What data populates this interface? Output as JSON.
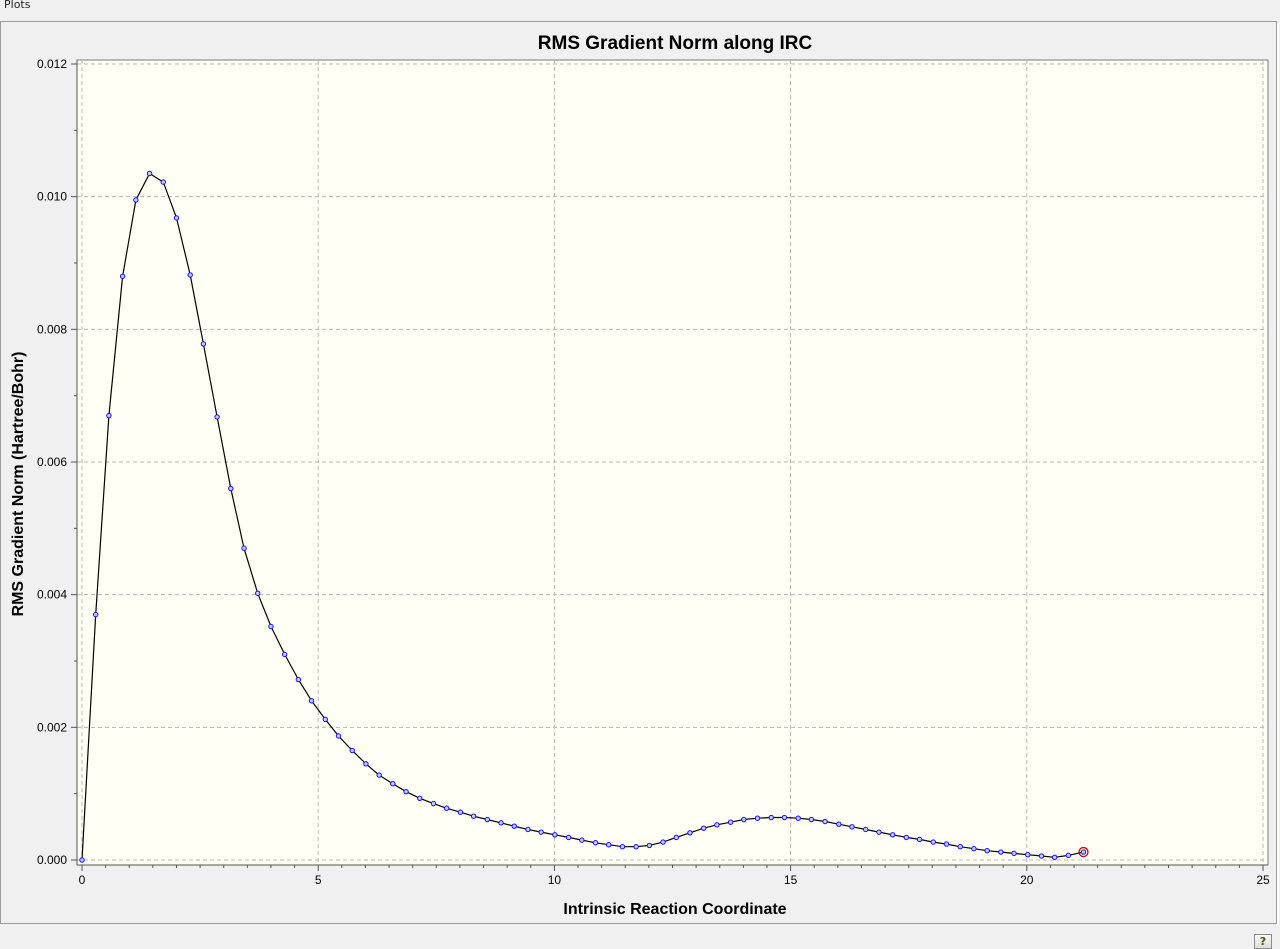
{
  "window": {
    "title": "Plots"
  },
  "help_icon": "help-icon",
  "chart_data": {
    "type": "line",
    "title": "RMS Gradient Norm along IRC",
    "xlabel": "Intrinsic Reaction Coordinate",
    "ylabel": "RMS Gradient Norm (Hartree/Bohr)",
    "xlim": [
      0,
      25
    ],
    "ylim": [
      0,
      0.012
    ],
    "x_ticks": [
      "0",
      "5",
      "10",
      "15",
      "20",
      "25"
    ],
    "y_ticks": [
      "0.000",
      "0.002",
      "0.004",
      "0.006",
      "0.008",
      "0.010",
      "0.012"
    ],
    "grid": true,
    "colors": {
      "line": "#000000",
      "marker": "#1010ff",
      "last_marker": "#d00000",
      "plot_bg": "#fffff5"
    },
    "series": [
      {
        "x": [
          0.0,
          0.29,
          0.57,
          0.86,
          1.14,
          1.43,
          1.72,
          2.0,
          2.29,
          2.57,
          2.86,
          3.15,
          3.43,
          3.72,
          4.0,
          4.29,
          4.58,
          4.86,
          5.15,
          5.43,
          5.72,
          6.01,
          6.29,
          6.58,
          6.86,
          7.15,
          7.44,
          7.72,
          8.01,
          8.29,
          8.58,
          8.87,
          9.15,
          9.44,
          9.72,
          10.01,
          10.3,
          10.58,
          10.87,
          11.15,
          11.44,
          11.73,
          12.01,
          12.3,
          12.58,
          12.87,
          13.16,
          13.44,
          13.73,
          14.01,
          14.3,
          14.59,
          14.87,
          15.16,
          15.44,
          15.73,
          16.02,
          16.3,
          16.59,
          16.87,
          17.16,
          17.45,
          17.73,
          18.02,
          18.3,
          18.59,
          18.88,
          19.16,
          19.45,
          19.73,
          20.02,
          20.31,
          20.59,
          20.88,
          21.2
        ],
        "y": [
          0.0,
          0.0037,
          0.0067,
          0.0088,
          0.00995,
          0.01035,
          0.01022,
          0.00968,
          0.00882,
          0.00778,
          0.00668,
          0.0056,
          0.0047,
          0.00402,
          0.00352,
          0.0031,
          0.00272,
          0.0024,
          0.00212,
          0.00187,
          0.00165,
          0.00145,
          0.00128,
          0.00115,
          0.00103,
          0.00093,
          0.00085,
          0.00078,
          0.00072,
          0.00066,
          0.00061,
          0.00056,
          0.00051,
          0.00046,
          0.00042,
          0.00038,
          0.00034,
          0.0003,
          0.00026,
          0.00023,
          0.0002,
          0.0002,
          0.00022,
          0.00027,
          0.00034,
          0.00041,
          0.00048,
          0.00053,
          0.00057,
          0.00061,
          0.00063,
          0.00064,
          0.00064,
          0.00063,
          0.00061,
          0.00058,
          0.00054,
          0.0005,
          0.00046,
          0.00042,
          0.00038,
          0.00034,
          0.00031,
          0.00027,
          0.00024,
          0.0002,
          0.00017,
          0.00014,
          0.00012,
          0.0001,
          8e-05,
          6e-05,
          4e-05,
          7e-05,
          0.00012
        ]
      }
    ]
  }
}
